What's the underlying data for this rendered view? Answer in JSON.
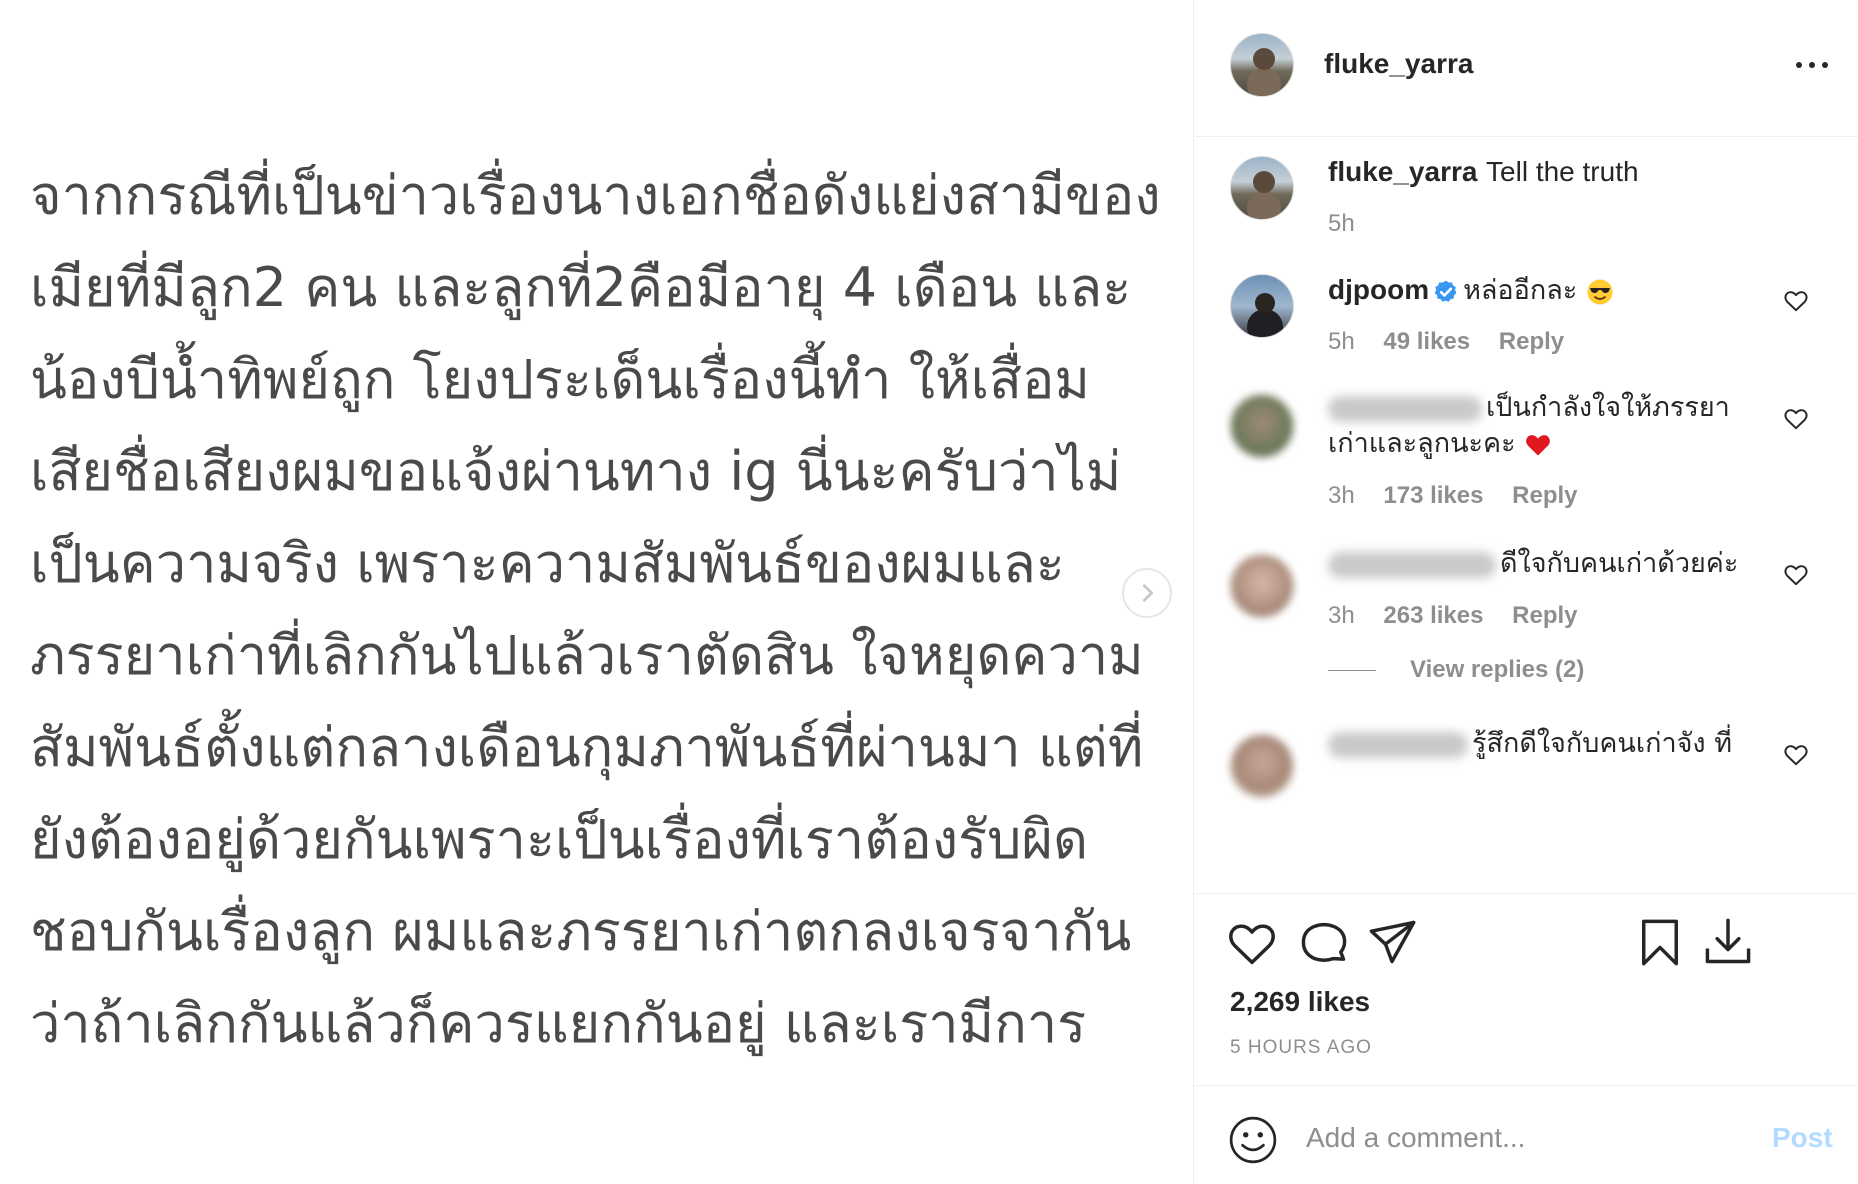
{
  "post": {
    "text_lines": [
      "จากกรณีที่เป็นข่าวเรื่องนางเอกชื่อดังแย่งสามีของ",
      "เมียที่มีลูก2 คน และลูกที่2คือมีอายุ 4 เดือน และ",
      "น้องบีน้ำทิพย์ถูก โยงประเด็นเรื่องนี้ทำ ให้เสื่อม",
      "เสียชื่อเสียงผมขอแจ้งผ่านทาง ig นี่นะครับว่าไม่",
      "เป็นความจริง เพราะความสัมพันธ์ของผมและ",
      "ภรรยาเก่าที่เลิกกันไปแล้วเราตัดสิน ใจหยุดความ",
      "สัมพันธ์ตั้งแต่กลางเดือนกุมภาพันธ์ที่ผ่านมา แต่ที่",
      "ยังต้องอยู่ด้วยกันเพราะเป็นเรื่องที่เราต้องรับผิด",
      "ชอบกันเรื่องลูก ผมและภรรยาเก่าตกลงเจรจากัน",
      "ว่าถ้าเลิกกันแล้วก็ควรแยกกันอยู่ และเรามีการ"
    ]
  },
  "header": {
    "username": "fluke_yarra"
  },
  "caption": {
    "username": "fluke_yarra",
    "text": "Tell the truth",
    "time": "5h"
  },
  "comments": [
    {
      "username": "djpoom",
      "verified": true,
      "text": "หล่ออีกละ",
      "emoji": "sunglasses-emoji",
      "time": "5h",
      "likes": "49 likes",
      "reply": "Reply"
    },
    {
      "username_hidden": true,
      "text_line1": "เป็นกำลังใจให้ภรรยา",
      "text_line2": "เก่าและลูกนะคะ",
      "emoji": "red-heart-emoji",
      "time": "3h",
      "likes": "173 likes",
      "reply": "Reply"
    },
    {
      "username_hidden": true,
      "text": "ดีใจกับคนเก่าด้วยค่ะ",
      "time": "3h",
      "likes": "263 likes",
      "reply": "Reply"
    },
    {
      "username_hidden": true,
      "text": "รู้สึกดีใจกับคนเก่าจัง ที่"
    }
  ],
  "view_replies": "View replies (2)",
  "actions": {
    "likes": "2,269 likes",
    "time_ago": "5 HOURS AGO"
  },
  "add_comment": {
    "placeholder": "Add a comment...",
    "post_label": "Post"
  },
  "colors": {
    "text": "#262626",
    "muted": "#8e8e8e",
    "verified_blue": "#3897f0",
    "post_disabled": "#b3dbff",
    "border": "#efefef"
  }
}
